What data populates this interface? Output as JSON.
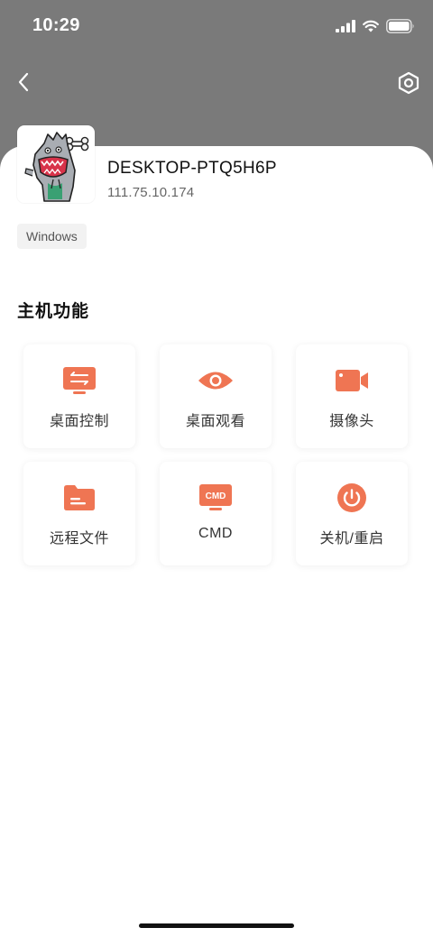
{
  "status_bar": {
    "time": "10:29"
  },
  "nav": {
    "back_icon": "chevron-left-icon",
    "settings_icon": "hexagon-settings-icon"
  },
  "host": {
    "name": "DESKTOP-PTQ5H6P",
    "ip": "111.75.10.174",
    "os_tag": "Windows"
  },
  "section": {
    "title": "主机功能"
  },
  "features": [
    {
      "label": "桌面控制",
      "icon": "desktop-control-icon"
    },
    {
      "label": "桌面观看",
      "icon": "eye-icon"
    },
    {
      "label": "摄像头",
      "icon": "camera-icon"
    },
    {
      "label": "远程文件",
      "icon": "folder-icon"
    },
    {
      "label": "CMD",
      "icon": "cmd-terminal-icon",
      "icon_text": "CMD"
    },
    {
      "label": "关机/重启",
      "icon": "power-icon"
    }
  ],
  "colors": {
    "accent": "#ef7553",
    "header_bg": "#7a7a7a"
  }
}
